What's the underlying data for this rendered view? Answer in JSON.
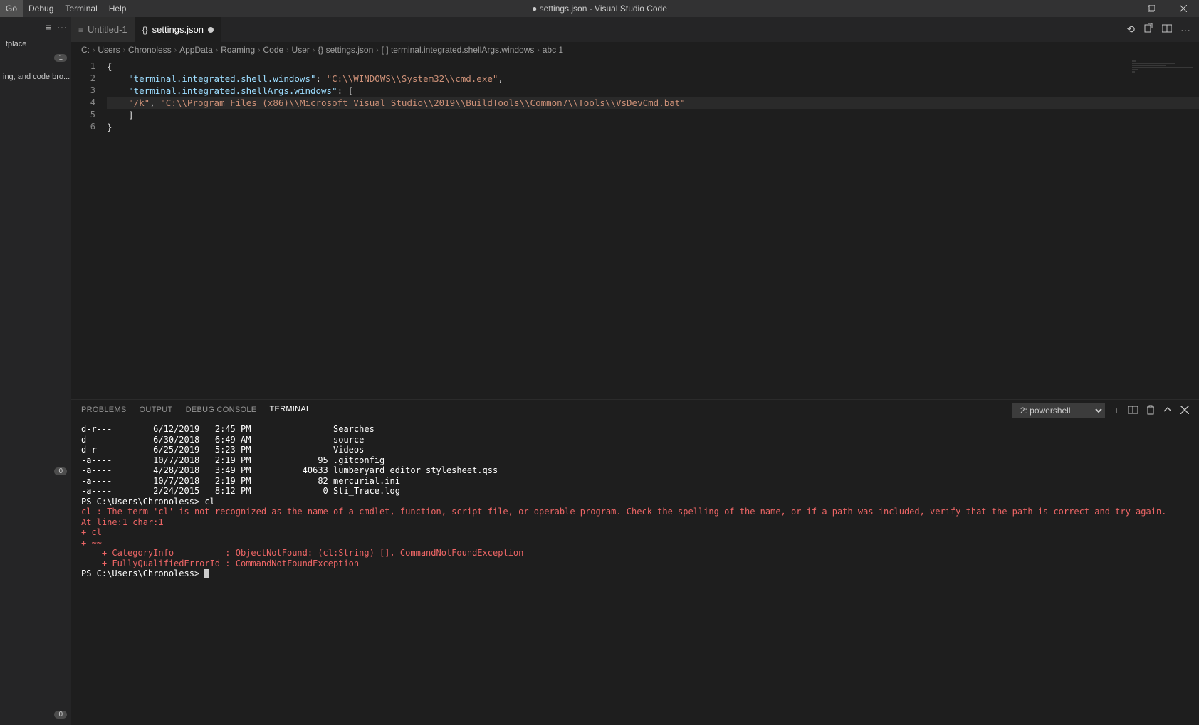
{
  "menu": [
    "Go",
    "Debug",
    "Terminal",
    "Help"
  ],
  "window": {
    "title": "● settings.json - Visual Studio Code"
  },
  "sidebar": {
    "item_marketplace": "tplace",
    "badge_enabled": "1",
    "item_desc": "ing, and code bro...",
    "bottom_badge": "0",
    "badge_zero": "0"
  },
  "tabs": [
    {
      "label": "Untitled-1",
      "icon": "≡",
      "dirty": false,
      "active": false
    },
    {
      "label": "settings.json",
      "icon": "{}",
      "dirty": true,
      "active": true
    }
  ],
  "breadcrumbs": [
    "C:",
    "Users",
    "Chronoless",
    "AppData",
    "Roaming",
    "Code",
    "User",
    "{} settings.json",
    "[ ] terminal.integrated.shellArgs.windows",
    "abc 1"
  ],
  "code": {
    "l1": "{",
    "l2_key": "\"terminal.integrated.shell.windows\"",
    "l2_val": "\"C:\\\\WINDOWS\\\\System32\\\\cmd.exe\"",
    "l3_key": "\"terminal.integrated.shellArgs.windows\"",
    "l4_a": "\"/k\"",
    "l4_b": "\"C:\\\\Program Files (x86)\\\\Microsoft Visual Studio\\\\2019\\\\BuildTools\\\\Common7\\\\Tools\\\\VsDevCmd.bat\"",
    "l5": "]",
    "l6": "}"
  },
  "panel": {
    "tabs": [
      "PROBLEMS",
      "OUTPUT",
      "DEBUG CONSOLE",
      "TERMINAL"
    ],
    "active_tab": "TERMINAL",
    "term_select": "2: powershell"
  },
  "terminal_lines": [
    {
      "cls": "term-white",
      "text": "d-r---        6/12/2019   2:45 PM                Searches"
    },
    {
      "cls": "term-white",
      "text": "d-----        6/30/2018   6:49 AM                source"
    },
    {
      "cls": "term-white",
      "text": "d-r---        6/25/2019   5:23 PM                Videos"
    },
    {
      "cls": "term-white",
      "text": "-a----        10/7/2018   2:19 PM             95 .gitconfig"
    },
    {
      "cls": "term-white",
      "text": "-a----        4/28/2018   3:49 PM          40633 lumberyard_editor_stylesheet.qss"
    },
    {
      "cls": "term-white",
      "text": "-a----        10/7/2018   2:19 PM             82 mercurial.ini"
    },
    {
      "cls": "term-white",
      "text": "-a----        2/24/2015   8:12 PM              0 Sti_Trace.log"
    },
    {
      "cls": "term-white",
      "text": ""
    },
    {
      "cls": "term-white",
      "text": ""
    },
    {
      "cls": "term-white",
      "text": "PS C:\\Users\\Chronoless> cl"
    },
    {
      "cls": "term-red",
      "text": "cl : The term 'cl' is not recognized as the name of a cmdlet, function, script file, or operable program. Check the spelling of the name, or if a path was included, verify that the path is correct and try again."
    },
    {
      "cls": "term-red",
      "text": "At line:1 char:1"
    },
    {
      "cls": "term-red",
      "text": "+ cl"
    },
    {
      "cls": "term-red",
      "text": "+ ~~"
    },
    {
      "cls": "term-red",
      "text": "    + CategoryInfo          : ObjectNotFound: (cl:String) [], CommandNotFoundException"
    },
    {
      "cls": "term-red",
      "text": "    + FullyQualifiedErrorId : CommandNotFoundException"
    },
    {
      "cls": "term-white",
      "text": ""
    }
  ],
  "terminal_prompt": "PS C:\\Users\\Chronoless> "
}
